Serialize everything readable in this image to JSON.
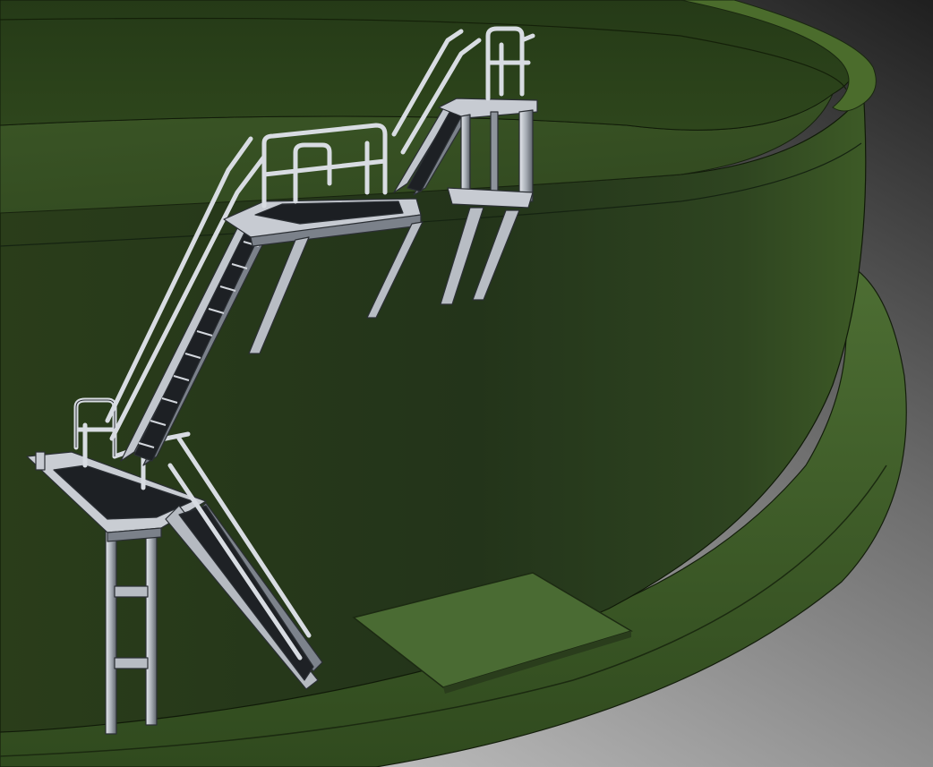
{
  "scene": {
    "subject": "",
    "colors": {
      "background_top": "#1f1f1f",
      "background_bottom": "#b8b8b8",
      "tank_wall_dark": "#1c2a12",
      "tank_wall_light": "#3e5a24",
      "tank_floor": "#3d5628",
      "rim_top": "#4a6a2c",
      "base_ledge": "#466330",
      "hatch_plate": "#4a6b33",
      "steel_light": "#d9dde3",
      "steel_mid": "#9aa1ab",
      "steel_dark": "#2f3338",
      "grating": "#1a1c1f"
    }
  }
}
